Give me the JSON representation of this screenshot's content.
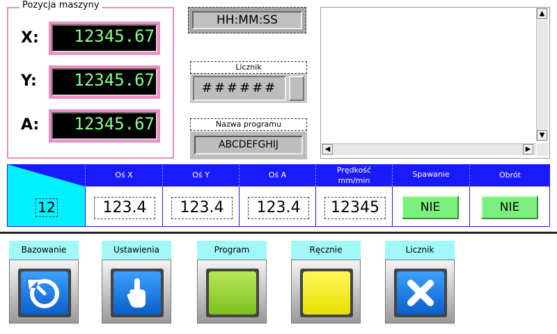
{
  "position_group": {
    "title": "Pozycja maszyny",
    "x_label": "X:",
    "x_value": "12345.67",
    "y_label": "Y:",
    "y_value": "12345.67",
    "a_label": "A:",
    "a_value": "12345.67"
  },
  "clock": {
    "value": "HH:MM:SS"
  },
  "counter": {
    "label": "Licznik",
    "value": "######"
  },
  "program": {
    "label": "Nazwa programu",
    "value": "ABCDEFGHIJ"
  },
  "scrollbar": {
    "up": "▲",
    "down": "▼",
    "left": "◀",
    "right": "▶"
  },
  "table": {
    "headers": [
      "Oś X",
      "Oś Y",
      "Oś A",
      "Prędkość mm/min",
      "Spawanie",
      "Obrót"
    ],
    "row_number": "12",
    "values": [
      "123.4",
      "123.4",
      "123.4",
      "12345"
    ],
    "spawanie": "NIE",
    "obrot": "NIE"
  },
  "nav": [
    {
      "label": "Bazowanie",
      "icon": "rotate-icon"
    },
    {
      "label": "Ustawienia",
      "icon": "hand-pointer-icon"
    },
    {
      "label": "Program",
      "icon": "green-square-icon"
    },
    {
      "label": "Ręcznie",
      "icon": "yellow-square-icon"
    },
    {
      "label": "Licznik",
      "icon": "close-icon"
    }
  ],
  "colors": {
    "accent_pink": "#f08cc4",
    "table_header_blue": "#1a1aff",
    "table_cyan": "#00f0ff",
    "led_green": "#8cff8c",
    "button_green": "#7cf07c",
    "nav_label_cyan": "#a0f8f8"
  }
}
